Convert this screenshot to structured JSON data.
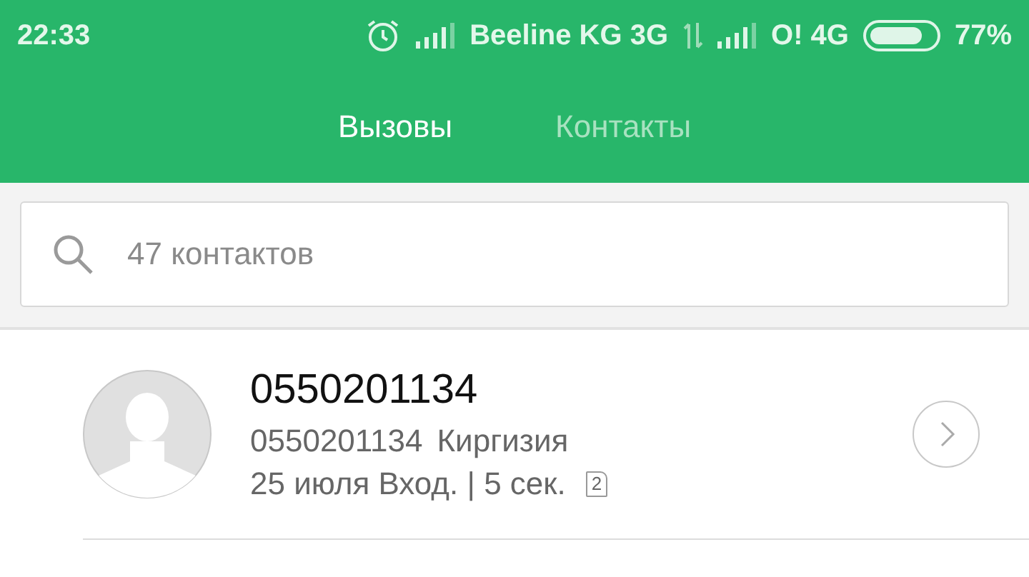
{
  "status_bar": {
    "time": "22:33",
    "carriers": [
      {
        "name": "Beeline KG 3G"
      },
      {
        "name": "O! 4G"
      }
    ],
    "battery": "77%"
  },
  "tabs": [
    {
      "label": "Вызовы",
      "selected": true
    },
    {
      "label": "Контакты",
      "selected": false
    }
  ],
  "search": {
    "placeholder": "47 контактов"
  },
  "calls": [
    {
      "name": "0550201134",
      "number": "0550201134",
      "location": "Киргизия",
      "details": "25 июля Вход. | 5 сек.",
      "sim": "2"
    }
  ]
}
